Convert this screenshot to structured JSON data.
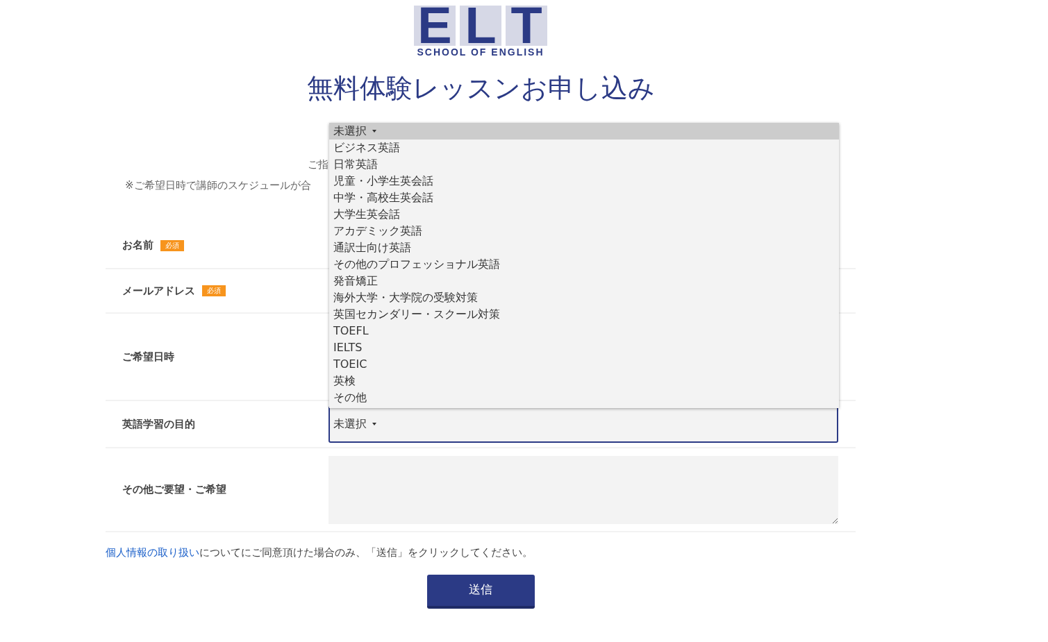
{
  "logo": {
    "letters": [
      "E",
      "L",
      "T"
    ],
    "tagline": "SCHOOL OF ENGLISH"
  },
  "title": "無料体験レッスンお申し込み",
  "notes": [
    "ご指",
    "※ご希望日時で講師のスケジュールが合"
  ],
  "form": {
    "rows": [
      {
        "label": "お名前",
        "badge": "必須",
        "kind": "hidden"
      },
      {
        "label": "メールアドレス",
        "badge": "必須",
        "kind": "hidden"
      },
      {
        "label": "ご希望日時",
        "kind": "hidden"
      },
      {
        "label": "英語学習の目的",
        "kind": "select",
        "value": "未選択"
      },
      {
        "label": "その他ご要望・ご希望",
        "kind": "textarea"
      }
    ]
  },
  "dropdown": {
    "options": [
      {
        "label": "未選択",
        "selected": true
      },
      {
        "label": "ビジネス英語",
        "selected": false
      },
      {
        "label": "日常英語",
        "selected": false
      },
      {
        "label": "児童・小学生英会話",
        "selected": false
      },
      {
        "label": "中学・高校生英会話",
        "selected": false
      },
      {
        "label": "大学生英会話",
        "selected": false
      },
      {
        "label": "アカデミック英語",
        "selected": false
      },
      {
        "label": "通訳士向け英語",
        "selected": false
      },
      {
        "label": "その他のプロフェッショナル英語",
        "selected": false
      },
      {
        "label": "発音矯正",
        "selected": false
      },
      {
        "label": "海外大学・大学院の受験対策",
        "selected": false
      },
      {
        "label": "英国セカンダリー・スクール対策",
        "selected": false
      },
      {
        "label": "TOEFL",
        "selected": false
      },
      {
        "label": "IELTS",
        "selected": false
      },
      {
        "label": "TOEIC",
        "selected": false
      },
      {
        "label": "英検",
        "selected": false
      },
      {
        "label": "その他",
        "selected": false
      }
    ]
  },
  "consent": {
    "link": "個人情報の取り扱い",
    "text": "についてにご同意頂けた場合のみ、「送信」をクリックしてください。"
  },
  "submit": "送信"
}
